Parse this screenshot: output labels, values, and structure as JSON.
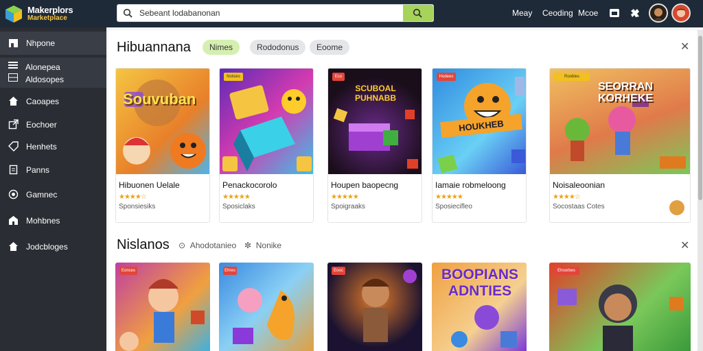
{
  "app": {
    "logo_line1": "Makerplors",
    "logo_line2": "Marketplace"
  },
  "search": {
    "value": "Sebeant lodabanonan"
  },
  "top_nav": {
    "links": [
      "Meay",
      "Ceoding",
      "Mcoe"
    ]
  },
  "sidebar": {
    "items": [
      {
        "label": "Nhpone",
        "icon": "store-icon",
        "active": true
      },
      {
        "label": "Caoapes",
        "icon": "home-icon"
      },
      {
        "label": "Eochoer",
        "icon": "external-link-icon"
      },
      {
        "label": "Henhets",
        "icon": "tag-icon"
      },
      {
        "label": "Panns",
        "icon": "file-icon"
      },
      {
        "label": "Gamnec",
        "icon": "target-icon"
      },
      {
        "label": "Mohbnes",
        "icon": "house-icon"
      },
      {
        "label": "Jodcbloges",
        "icon": "home-filled-icon"
      }
    ],
    "group": [
      "Alonepea",
      "Aldosopes"
    ]
  },
  "section1": {
    "title": "Hibuannana",
    "chips": [
      {
        "label": "Nimes",
        "active": true
      },
      {
        "label": "Rododonus",
        "active": false
      },
      {
        "label": "Eoome",
        "active": false
      }
    ],
    "cards": [
      {
        "title": "Hibuonen Uelale",
        "price": "Sponsiesiks",
        "art": "Souvuban",
        "badge": ""
      },
      {
        "title": "Penackocorolo",
        "price": "Sposiclaks",
        "art": "",
        "badge": "Nolsies"
      },
      {
        "title": "Houpen baopecng",
        "price": "Spoigraaks",
        "art": "SCUBOAL PUHNABB",
        "badge": "Eco"
      },
      {
        "title": "Iamaie robmeloong",
        "price": "Sposiecifleo",
        "art": "HOUKHEB",
        "badge": "Hodees"
      },
      {
        "title": "Noisaleoonian",
        "price": "Socostaas Cotes",
        "art": "SEORRAN KORHEKE",
        "badge": "Roobles"
      }
    ]
  },
  "section2": {
    "title": "Nislanos",
    "meta": [
      "Ahodotanieo",
      "Nonike"
    ],
    "cards": [
      {
        "badge": "Eonces"
      },
      {
        "badge": "Ehres"
      },
      {
        "badge": "Eooc"
      },
      {
        "art": "BOOPIANS ADNTIES"
      },
      {
        "badge": "Ehoorbes"
      }
    ]
  }
}
